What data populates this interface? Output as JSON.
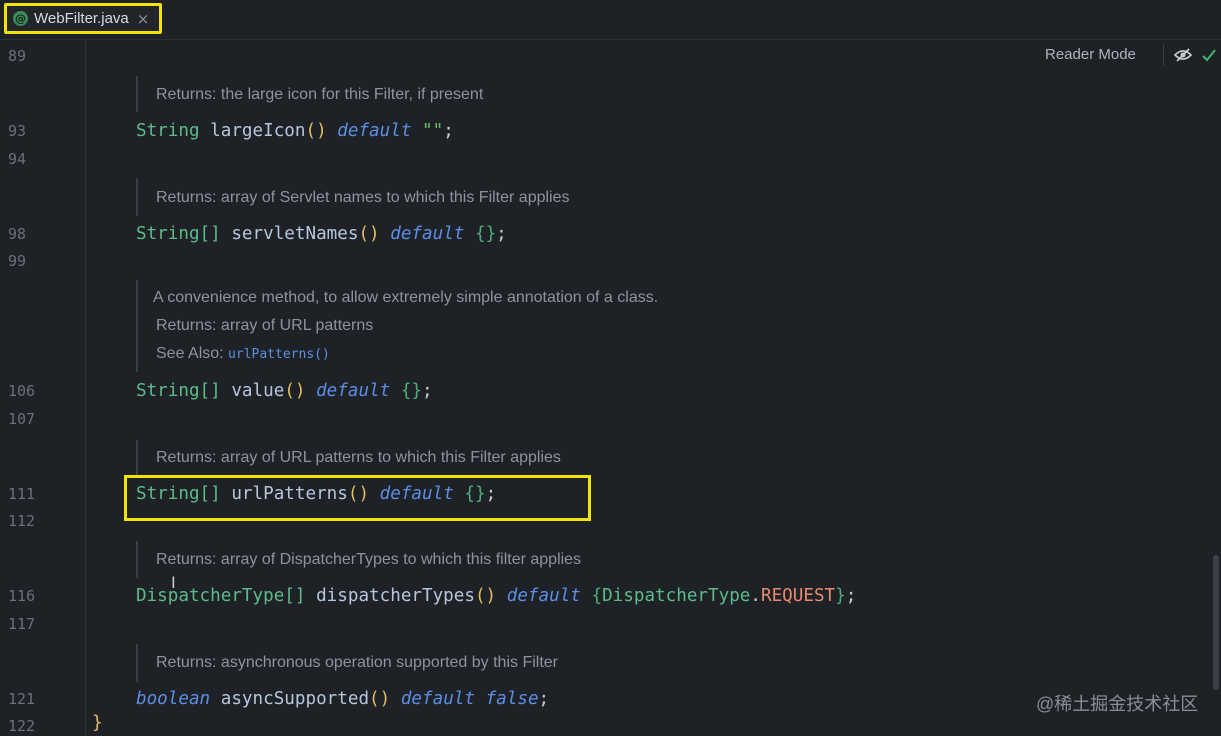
{
  "tab": {
    "icon": "@",
    "label": "WebFilter.java",
    "close": "×"
  },
  "toolbar": {
    "reader_mode": "Reader Mode"
  },
  "line_numbers": [
    "89",
    "93",
    "94",
    "98",
    "99",
    "106",
    "107",
    "111",
    "112",
    "116",
    "117",
    "121",
    "122"
  ],
  "docs": {
    "d1": "Returns: the large icon for this Filter, if present",
    "d2": "Returns: array of Servlet names to which this Filter applies",
    "d3a": "A convenience method, to allow extremely simple annotation of a class.",
    "d3b": "Returns:  array of URL patterns",
    "d3c_label": "See Also: ",
    "d3c_link": "urlPatterns()",
    "d4": "Returns: array of URL patterns to which this Filter applies",
    "d5": "Returns: array of DispatcherTypes to which this filter applies",
    "d6": "Returns: asynchronous operation supported by this Filter"
  },
  "code": {
    "c93": {
      "type": "String",
      "name": " largeIcon",
      "parens": "()",
      "kw": "default",
      "val": "\"\"",
      "end": ";"
    },
    "c98": {
      "type": "String[]",
      "name": " servletNames",
      "parens": "()",
      "kw": "default",
      "val": "{}",
      "end": ";"
    },
    "c106": {
      "type": "String[]",
      "name": " value",
      "parens": "()",
      "kw": "default",
      "val": "{}",
      "end": ";"
    },
    "c111": {
      "type": "String[]",
      "name": " urlPatterns",
      "parens": "()",
      "kw": "default",
      "val": "{}",
      "end": ";"
    },
    "c116": {
      "type": "DispatcherType[]",
      "name": " dispatcherTypes",
      "parens": "()",
      "kw": "default",
      "open": "{",
      "vtype": "DispatcherType",
      "dot": ".",
      "const": "REQUEST",
      "close": "}",
      "end": ";"
    },
    "c121": {
      "type": "boolean",
      "name": " asyncSupported",
      "parens": "()",
      "kw": "default",
      "val": "false",
      "end": ";"
    },
    "c122": "}"
  },
  "watermark": "@稀土掘金技术社区"
}
